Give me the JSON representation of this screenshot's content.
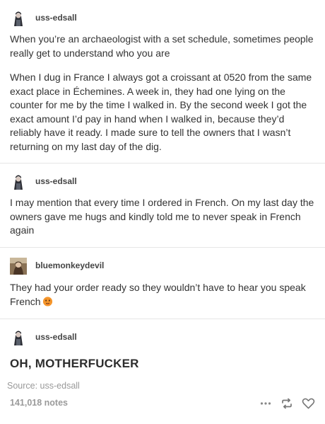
{
  "blocks": [
    {
      "username": "uss-edsall",
      "paragraphs": [
        "When you’re an archaeologist with a set schedule, sometimes people really get to understand who you are",
        "When I dug in France I always got a croissant at 0520 from the same exact place in Échemines. A week in, they had one lying on the counter for me by the time I walked in. By the second week I got the exact amount I’d pay in hand when I walked in, because they’d reliably have it ready. I made sure to tell the owners that I wasn’t returning on my last day of the dig."
      ]
    },
    {
      "username": "uss-edsall",
      "paragraphs": [
        "I may mention that every time I ordered in French. On my last day the owners gave me hugs and kindly told me to never speak in French again"
      ]
    },
    {
      "username": "bluemonkeydevil",
      "paragraphs": [
        "They had your order ready so they wouldn’t have to hear you speak French"
      ]
    },
    {
      "username": "uss-edsall",
      "headline": "OH, MOTHERFUCKER"
    }
  ],
  "footer": {
    "source": "Source: uss-edsall",
    "notes": "141,018 notes"
  },
  "icons": {
    "more": "more-dots-icon",
    "reblog": "reblog-icon",
    "like": "heart-icon",
    "emoji": "hot-face-emoji"
  },
  "colors": {
    "text": "#333333",
    "muted": "#999999",
    "divider": "#e6e6e6"
  }
}
